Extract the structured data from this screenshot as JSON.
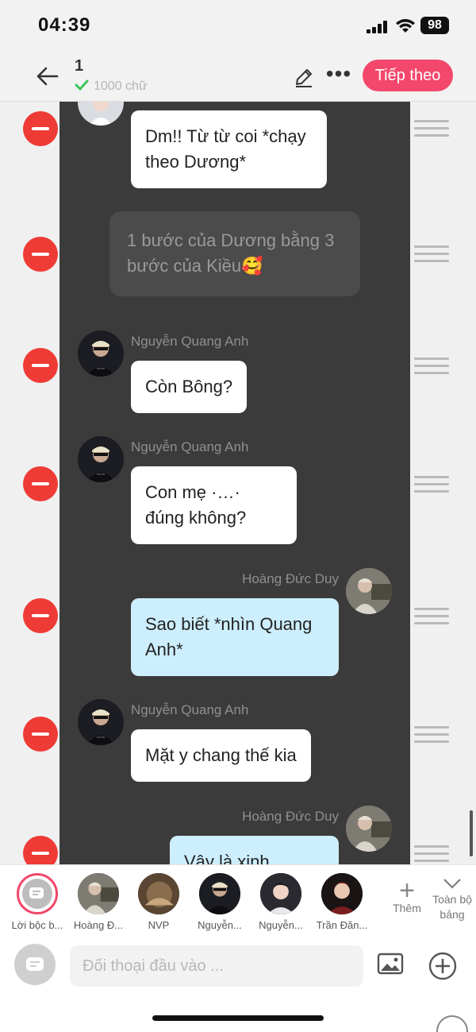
{
  "status_bar": {
    "time": "04:39",
    "battery": "98"
  },
  "header": {
    "title": "1",
    "word_count": "1000 chữ",
    "next_label": "Tiếp theo"
  },
  "messages": [
    {
      "type": "bubble",
      "sender": "",
      "text": "Dm!! Từ từ coi *chạy theo Dương*",
      "side": "left",
      "color": "white"
    },
    {
      "type": "narration",
      "text": "1 bước của Dương bằng 3 bước của Kiều🥰"
    },
    {
      "type": "bubble",
      "sender": "Nguyễn Quang Anh",
      "text": "Còn Bông?",
      "side": "left",
      "color": "white"
    },
    {
      "type": "bubble",
      "sender": "Nguyễn Quang Anh",
      "text": "Con mẹ ·…· đúng không?",
      "side": "left",
      "color": "white"
    },
    {
      "type": "bubble",
      "sender": "Hoàng Đức Duy",
      "text": "Sao biết *nhìn Quang Anh*",
      "side": "right",
      "color": "blue"
    },
    {
      "type": "bubble",
      "sender": "Nguyễn Quang Anh",
      "text": "Mặt y chang thế kia",
      "side": "left",
      "color": "white"
    },
    {
      "type": "bubble",
      "sender": "Hoàng Đức Duy",
      "text": "Vậy là xinh",
      "side": "right",
      "color": "blue"
    }
  ],
  "characters": [
    {
      "label": "Lời bộc b...",
      "selected": true
    },
    {
      "label": "Hoàng Đ..."
    },
    {
      "label": "NVP"
    },
    {
      "label": "Nguyễn..."
    },
    {
      "label": "Nguyễn..."
    },
    {
      "label": "Trần Đăn..."
    }
  ],
  "char_actions": {
    "add_label": "Thêm",
    "all_board_label": "Toàn bộ bảng"
  },
  "input": {
    "placeholder": "Đối thoại đầu vào ..."
  },
  "colors": {
    "accent": "#f3476b",
    "delete": "#ef3b36",
    "panel": "#3b3b3b",
    "bubble_blue": "#cdeefd"
  }
}
